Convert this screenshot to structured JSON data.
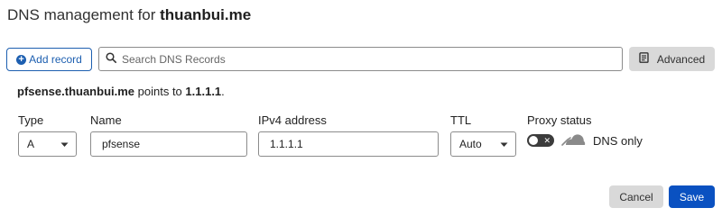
{
  "header": {
    "title_prefix": "DNS management for",
    "domain": "thuanbui.me"
  },
  "toolbar": {
    "add_record_label": "Add record",
    "add_icon": "plus-circle-icon",
    "search_placeholder": "Search DNS Records",
    "search_value": "",
    "search_icon": "search-icon",
    "advanced_label": "Advanced",
    "advanced_icon": "document-icon"
  },
  "summary": {
    "host": "pfsense.thuanbui.me",
    "middle": " points to ",
    "target": "1.1.1.1",
    "end": "."
  },
  "form": {
    "type_label": "Type",
    "type_value": "A",
    "name_label": "Name",
    "name_value": "pfsense",
    "ipv4_label": "IPv4 address",
    "ipv4_value": "1.1.1.1",
    "ttl_label": "TTL",
    "ttl_value": "Auto",
    "proxy_label": "Proxy status",
    "proxy_value": "DNS only",
    "proxy_enabled": false,
    "toggle_off_glyph": "✕"
  },
  "actions": {
    "cancel_label": "Cancel",
    "save_label": "Save"
  },
  "colors": {
    "primary": "#0a51c1",
    "link_blue": "#1d5fb0",
    "secondary_bg": "#d9d9d9",
    "border": "#8c8c8c",
    "toggle_off": "#3c3c3c",
    "cloud_grey": "#888888"
  }
}
